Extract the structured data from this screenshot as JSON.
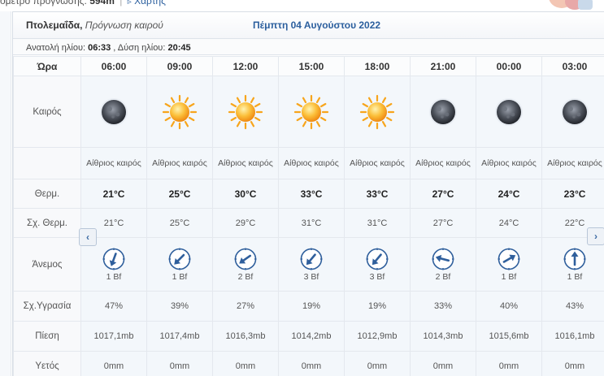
{
  "topline": {
    "prefix": "ομετρο πρόγνωσης:",
    "altitude": "594m",
    "link_label": "Χάρτης"
  },
  "header": {
    "city": "Πτολεμαΐδα,",
    "subtitle": "Πρόγνωση καιρού",
    "date": "Πέμπτη 04 Αυγούστου 2022"
  },
  "sun": {
    "sunrise_label": "Ανατολή ηλίου:",
    "sunrise": "06:33",
    "sunset_label": ", Δύση ηλίου:",
    "sunset": "20:45"
  },
  "labels": {
    "time": "Ώρα",
    "weather": "Καιρός",
    "temp": "Θερμ.",
    "feels": "Σχ. Θερμ.",
    "wind": "Άνεμος",
    "humidity": "Σχ.Υγρασία",
    "pressure": "Πίεση",
    "rain": "Υετός"
  },
  "forecast": [
    {
      "time": "06:00",
      "icon": "clear-night-moon-icon",
      "desc": "Αίθριος καιρός",
      "temp": "21°C",
      "feels": "21°C",
      "wind_dir_deg": 200,
      "bf": "1 Bf",
      "humidity": "47%",
      "pressure": "1017,1mb",
      "rain": "0mm"
    },
    {
      "time": "09:00",
      "icon": "sun-icon",
      "desc": "Αίθριος καιρός",
      "temp": "25°C",
      "feels": "25°C",
      "wind_dir_deg": 225,
      "bf": "1 Bf",
      "humidity": "39%",
      "pressure": "1017,4mb",
      "rain": "0mm"
    },
    {
      "time": "12:00",
      "icon": "sun-icon",
      "desc": "Αίθριος καιρός",
      "temp": "30°C",
      "feels": "29°C",
      "wind_dir_deg": 235,
      "bf": "2 Bf",
      "humidity": "27%",
      "pressure": "1016,3mb",
      "rain": "0mm"
    },
    {
      "time": "15:00",
      "icon": "sun-icon",
      "desc": "Αίθριος καιρός",
      "temp": "33°C",
      "feels": "31°C",
      "wind_dir_deg": 220,
      "bf": "3 Bf",
      "humidity": "19%",
      "pressure": "1014,2mb",
      "rain": "0mm"
    },
    {
      "time": "18:00",
      "icon": "sun-icon",
      "desc": "Αίθριος καιρός",
      "temp": "33°C",
      "feels": "31°C",
      "wind_dir_deg": 220,
      "bf": "3 Bf",
      "humidity": "19%",
      "pressure": "1012,9mb",
      "rain": "0mm"
    },
    {
      "time": "21:00",
      "icon": "clear-night-moon-icon",
      "desc": "Αίθριος καιρός",
      "temp": "27°C",
      "feels": "27°C",
      "wind_dir_deg": 285,
      "bf": "2 Bf",
      "humidity": "33%",
      "pressure": "1014,3mb",
      "rain": "0mm"
    },
    {
      "time": "00:00",
      "icon": "clear-night-moon-icon",
      "desc": "Αίθριος καιρός",
      "temp": "24°C",
      "feels": "24°C",
      "wind_dir_deg": 60,
      "bf": "1 Bf",
      "humidity": "40%",
      "pressure": "1015,6mb",
      "rain": "0mm"
    },
    {
      "time": "03:00",
      "icon": "clear-night-moon-icon",
      "desc": "Αίθριος καιρός",
      "temp": "23°C",
      "feels": "22°C",
      "wind_dir_deg": 0,
      "bf": "1 Bf",
      "humidity": "43%",
      "pressure": "1016,1mb",
      "rain": "0mm"
    }
  ],
  "colors": {
    "accent": "#2b5f9e",
    "wind_arrow": "#2f5f9c",
    "sun": "#f7a51c",
    "moon": "#4a4f58"
  }
}
